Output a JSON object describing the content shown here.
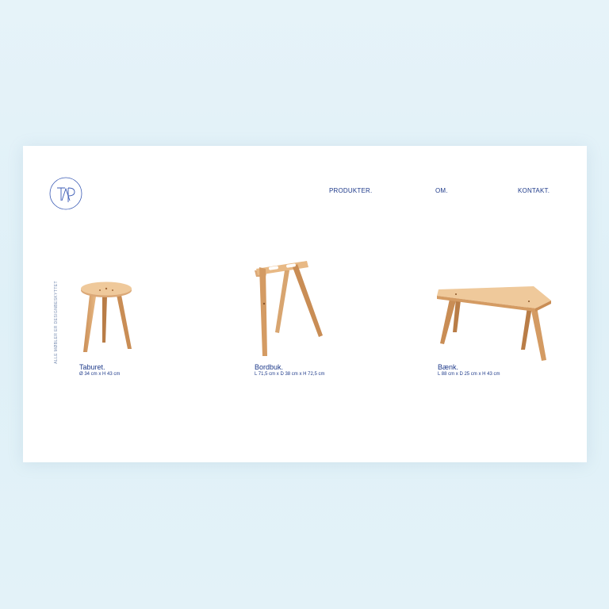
{
  "brand": {
    "logo_text": "TAP"
  },
  "nav": [
    {
      "label": "PRODUKTER."
    },
    {
      "label": "OM."
    },
    {
      "label": "KONTAKT."
    }
  ],
  "side_text": "ALLE MØBLER ER DESIGNBESKYTTET",
  "products": [
    {
      "name": "Taburet.",
      "dimensions": "Ø 34 cm x H 43 cm",
      "icon": "stool-image"
    },
    {
      "name": "Bordbuk.",
      "dimensions": "L 71,5 cm x D 38 cm x H 72,5 cm",
      "icon": "trestle-image"
    },
    {
      "name": "Bænk.",
      "dimensions": "L 88 cm x D 25 cm x H 43 cm",
      "icon": "bench-image"
    }
  ],
  "colors": {
    "accent": "#1e3a8a",
    "wood": "#d9a16b",
    "background": "#e3f2f8"
  }
}
